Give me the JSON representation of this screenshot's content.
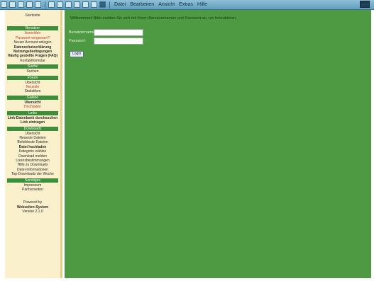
{
  "toolbar": {
    "menu": [
      "Datei",
      "Bearbeiten",
      "Ansicht",
      "Extras",
      "Hilfe"
    ]
  },
  "sidebar": {
    "top_label": "Startseite",
    "sections": [
      {
        "header": "Benutzer",
        "items": [
          {
            "label": "Anmelden",
            "style": "red"
          },
          {
            "label": "Passwort vergessen?",
            "style": "red"
          },
          {
            "label": "Neuen Account anlegen",
            "style": ""
          },
          {
            "label": "Datenschutzerklärung",
            "style": "bold"
          },
          {
            "label": "Nutzungsbedingungen",
            "style": "bold"
          },
          {
            "label": "Häufig gestellte Fragen (FAQ)",
            "style": "bold"
          },
          {
            "label": "Kontaktformular",
            "style": ""
          }
        ]
      },
      {
        "header": "Suche",
        "items": [
          {
            "label": "Suchen",
            "style": ""
          }
        ]
      },
      {
        "header": "Forum",
        "items": [
          {
            "label": "Übersicht",
            "style": ""
          },
          {
            "label": "Neueste",
            "style": "red"
          },
          {
            "label": "Statistiken",
            "style": ""
          }
        ]
      },
      {
        "header": "Galerie",
        "items": [
          {
            "label": "Übersicht",
            "style": "bold"
          },
          {
            "label": "Hochladen",
            "style": "red"
          }
        ]
      },
      {
        "header": "Links",
        "items": [
          {
            "label": "Link-Datenbank durchsuchen",
            "style": "bold"
          },
          {
            "label": "Link eintragen",
            "style": "bold"
          }
        ]
      },
      {
        "header": "Downloads",
        "items": [
          {
            "label": "Übersicht",
            "style": ""
          },
          {
            "label": "Neueste Dateien",
            "style": ""
          },
          {
            "label": "Beliebteste Dateien",
            "style": ""
          },
          {
            "label": "Datei hochladen",
            "style": "bold"
          },
          {
            "label": "Kategorie wählen",
            "style": ""
          },
          {
            "label": "Download melden",
            "style": ""
          },
          {
            "label": "Lizenzbestimmungen",
            "style": ""
          },
          {
            "label": "Hilfe zu Downloads",
            "style": ""
          },
          {
            "label": "Datei-Informationen",
            "style": ""
          },
          {
            "label": "Top-Downloads der Woche",
            "style": ""
          }
        ]
      },
      {
        "header": "Sonstiges",
        "items": [
          {
            "label": "Impressum",
            "style": ""
          },
          {
            "label": "Partnerseiten",
            "style": ""
          }
        ]
      }
    ],
    "footer": [
      "Powered by",
      "Webseiten-System",
      "Version 2.1.0"
    ]
  },
  "main": {
    "intro": "Willkommen! Bitte melden Sie sich mit Ihrem Benutzernamen und Passwort an, um fortzufahren.",
    "username_label": "Benutzername:",
    "username_value": "",
    "password_label": "Passwort:",
    "password_value": "",
    "submit_label": "Login"
  }
}
